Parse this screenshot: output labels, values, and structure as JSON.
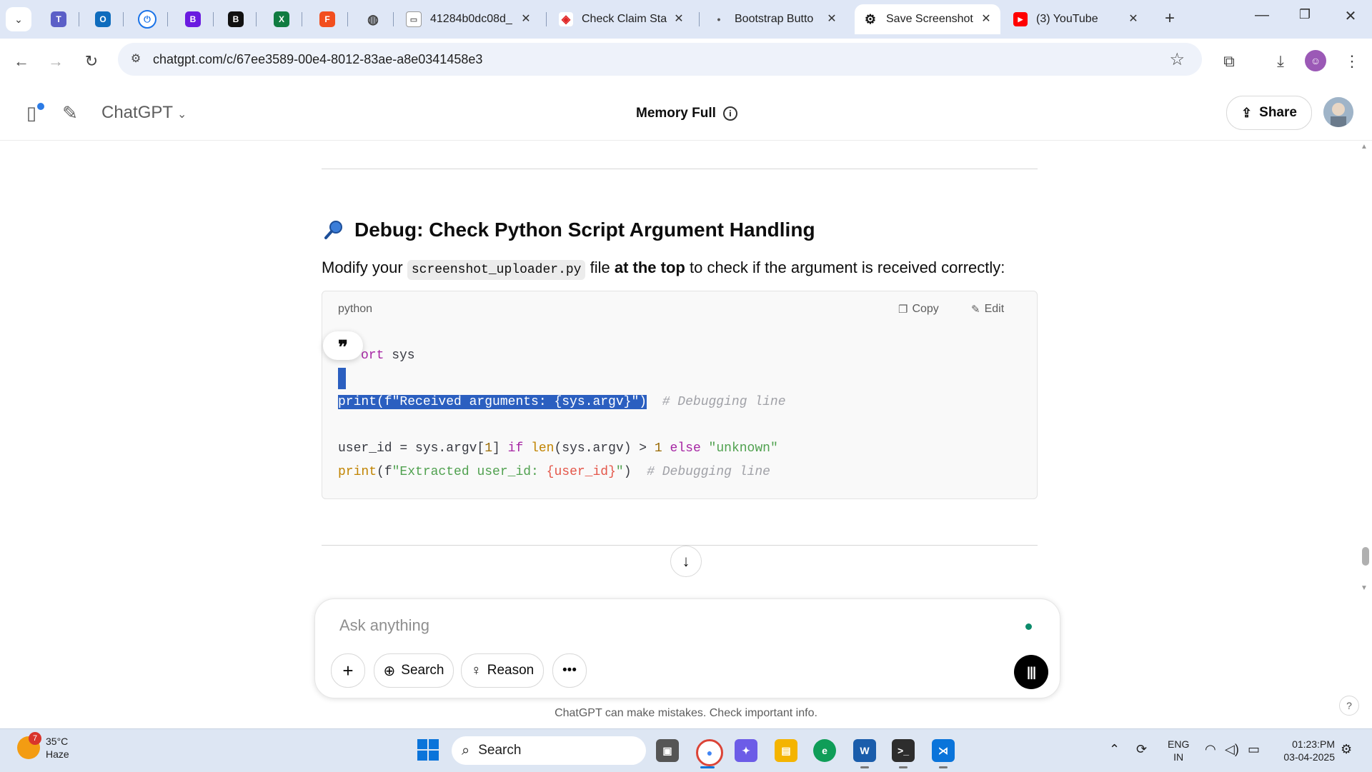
{
  "browser": {
    "tabs": [
      {
        "title": "41284b0dc08d_",
        "favicon": "page-icon",
        "active": false
      },
      {
        "title": "Check Claim Sta",
        "favicon": "claim-icon",
        "active": false
      },
      {
        "title": "Bootstrap Butto",
        "favicon": "dot-icon",
        "active": false
      },
      {
        "title": "Save Screenshot",
        "favicon": "chatgpt-icon",
        "active": true
      },
      {
        "title": "(3) YouTube",
        "favicon": "youtube-icon",
        "active": false
      }
    ],
    "url": "chatgpt.com/c/67ee3589-00e4-8012-83ae-a8e0341458e3"
  },
  "app": {
    "model_name": "ChatGPT",
    "memory_status": "Memory Full",
    "share_label": "Share"
  },
  "content": {
    "heading": "Debug: Check Python Script Argument Handling",
    "para_prefix": "Modify your",
    "para_code": "screenshot_uploader.py",
    "para_mid": "file",
    "para_bold": "at the top",
    "para_suffix": "to check if the argument is received correctly:",
    "code_lang": "python",
    "copy_label": "Copy",
    "edit_label": "Edit",
    "code": {
      "line1_kw": "ort",
      "line1_rest": " sys",
      "line3_sel": "print(f\"Received arguments: {sys.argv}\")",
      "line3_comment": "# Debugging line",
      "line5_a": "user_id = sys.argv[",
      "line5_num1": "1",
      "line5_b": "] ",
      "line5_if": "if",
      "line5_sp": " ",
      "line5_len": "len",
      "line5_c": "(sys.argv) > ",
      "line5_num2": "1",
      "line5_else": " else ",
      "line5_str": "\"unknown\"",
      "line6_print": "print",
      "line6_a": "(f",
      "line6_str1": "\"Extracted user_id: ",
      "line6_interp": "{user_id}",
      "line6_str2": "\"",
      "line6_b": ")  ",
      "line6_comment": "# Debugging line"
    }
  },
  "composer": {
    "placeholder": "Ask anything",
    "search_label": "Search",
    "reason_label": "Reason"
  },
  "disclaimer": "ChatGPT can make mistakes. Check important info.",
  "taskbar": {
    "weather_temp": "35°C",
    "weather_desc": "Haze",
    "weather_badge": "7",
    "search_label": "Search",
    "lang_line1": "ENG",
    "lang_line2": "IN",
    "time": "01:23:PM",
    "date": "03-04-2025"
  },
  "colors": {
    "selection": "#2b5fc0",
    "accent_blue": "#0a74da",
    "youtube_red": "#ff0000"
  }
}
